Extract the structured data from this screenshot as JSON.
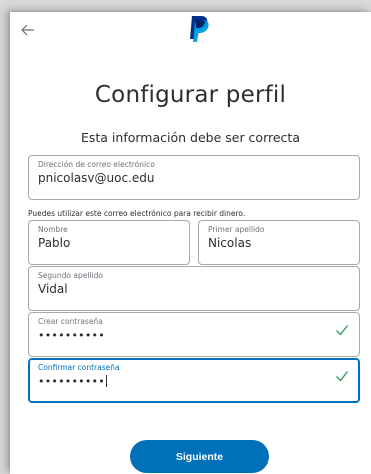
{
  "header": {
    "back_icon": "arrow-left-icon",
    "logo_icon": "paypal-logo-icon"
  },
  "page": {
    "title": "Configurar perfil",
    "subtitle": "Esta información debe ser correcta"
  },
  "form": {
    "email": {
      "label": "Dirección de correo electrónico",
      "value": "pnicolasv@uoc.edu"
    },
    "email_helper": "Puedes utilizar este correo electrónico para recibir dinero.",
    "first_name": {
      "label": "Nombre",
      "value": "Pablo"
    },
    "last_name": {
      "label": "Primer apellido",
      "value": "Nicolas"
    },
    "second_last_name": {
      "label": "Segundo apellido",
      "value": "Vidal"
    },
    "password": {
      "label": "Crear contraseña",
      "value": "••••••••••",
      "valid_icon": "checkmark-icon"
    },
    "confirm_password": {
      "label": "Confirmar contraseña",
      "value": "••••••••••",
      "valid_icon": "checkmark-icon"
    },
    "submit_label": "Siguiente"
  },
  "colors": {
    "brand_blue": "#0070ba",
    "valid_green": "#2a9c56",
    "paypal_dark_blue": "#003087",
    "paypal_light_blue": "#009cde"
  }
}
